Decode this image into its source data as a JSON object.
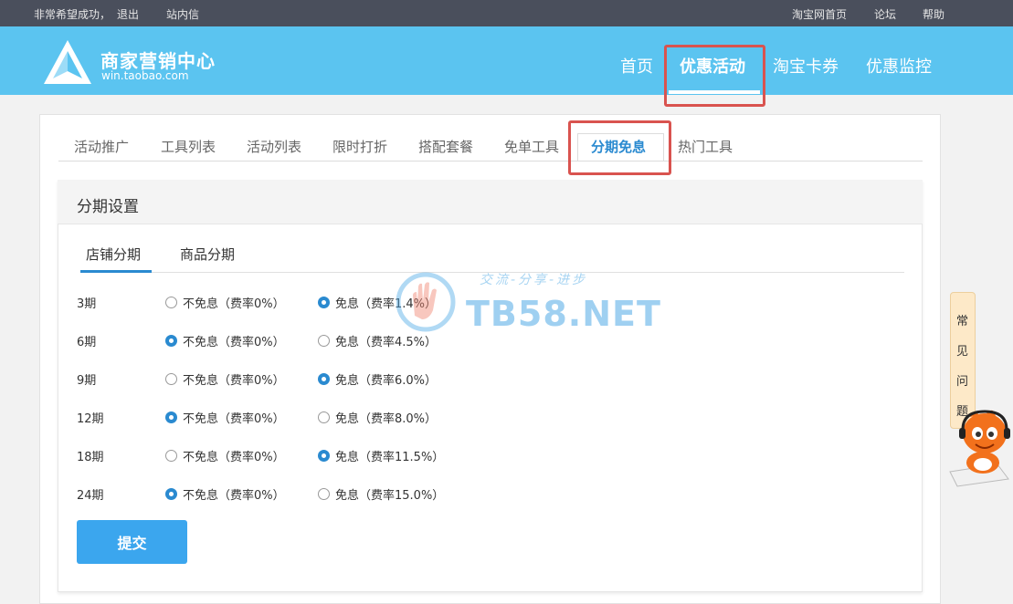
{
  "topbar": {
    "greeting": "非常希望成功，",
    "logout": "退出",
    "messages": "站内信",
    "taobao_home": "淘宝网首页",
    "forum": "论坛",
    "help": "帮助"
  },
  "header": {
    "logo_title": "商家营销中心",
    "logo_subtitle": "win.taobao.com",
    "nav": [
      "首页",
      "优惠活动",
      "淘宝卡券",
      "优惠监控"
    ],
    "active_nav": "优惠活动"
  },
  "subtabs": [
    "活动推广",
    "工具列表",
    "活动列表",
    "限时打折",
    "搭配套餐",
    "免单工具",
    "分期免息",
    "热门工具"
  ],
  "active_subtab": "分期免息",
  "panel": {
    "title": "分期设置",
    "tabs": [
      "店铺分期",
      "商品分期"
    ],
    "active_tab": "店铺分期",
    "rows": [
      {
        "period": "3期",
        "opt_no": "不免息（费率0%）",
        "opt_yes": "免息（费率1.4%）",
        "selected": "yes"
      },
      {
        "period": "6期",
        "opt_no": "不免息（费率0%）",
        "opt_yes": "免息（费率4.5%）",
        "selected": "no"
      },
      {
        "period": "9期",
        "opt_no": "不免息（费率0%）",
        "opt_yes": "免息（费率6.0%）",
        "selected": "yes"
      },
      {
        "period": "12期",
        "opt_no": "不免息（费率0%）",
        "opt_yes": "免息（费率8.0%）",
        "selected": "no"
      },
      {
        "period": "18期",
        "opt_no": "不免息（费率0%）",
        "opt_yes": "免息（费率11.5%）",
        "selected": "yes"
      },
      {
        "period": "24期",
        "opt_no": "不免息（费率0%）",
        "opt_yes": "免息（费率15.0%）",
        "selected": "no"
      }
    ],
    "submit_label": "提交"
  },
  "watermark": {
    "slogan": "交流-分享-进步",
    "text": "TB58.NET"
  },
  "faq": {
    "chars": [
      "常",
      "见",
      "问",
      "题"
    ]
  },
  "colors": {
    "header_bg": "#5bc4f0",
    "topbar_bg": "#4a4f5c",
    "accent": "#2a8ad0",
    "submit_bg": "#3ba6ee",
    "highlight_box": "#d9534f"
  }
}
